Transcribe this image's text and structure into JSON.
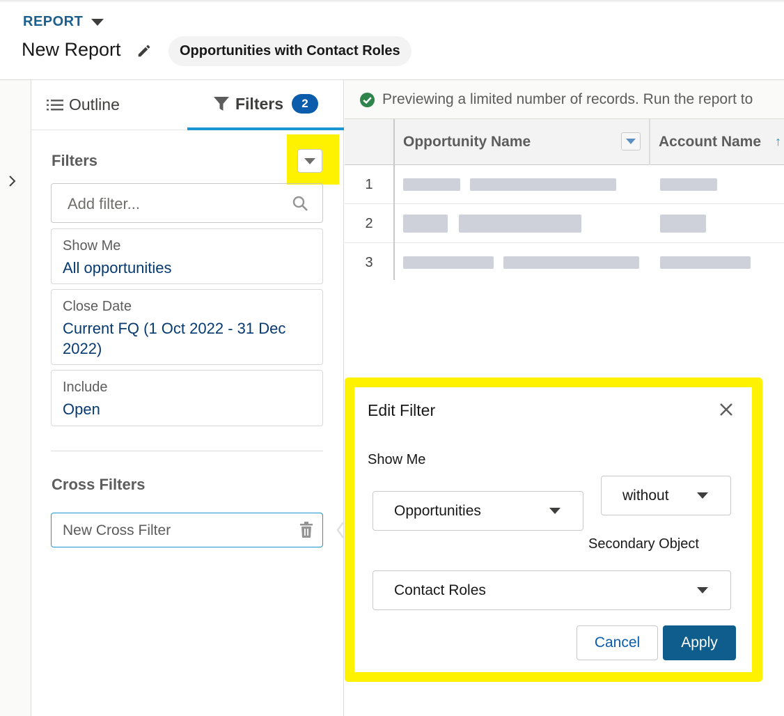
{
  "header": {
    "object_label": "REPORT",
    "report_title": "New Report",
    "report_type": "Opportunities with Contact Roles"
  },
  "panel": {
    "tabs": {
      "outline": "Outline",
      "filters": "Filters",
      "filters_count": "2"
    },
    "filters_section_title": "Filters",
    "add_filter_placeholder": "Add filter...",
    "filter_cards": [
      {
        "label": "Show Me",
        "value": "All opportunities"
      },
      {
        "label": "Close Date",
        "value": "Current FQ (1 Oct 2022 - 31 Dec 2022)"
      },
      {
        "label": "Include",
        "value": "Open"
      }
    ],
    "cross_filters_title": "Cross Filters",
    "cross_filter_item": "New Cross Filter"
  },
  "preview": {
    "notice": "Previewing a limited number of records. Run the report to",
    "columns": [
      "Opportunity Name",
      "Account Name"
    ],
    "rows": [
      "1",
      "2",
      "3"
    ]
  },
  "edit_filter": {
    "title": "Edit Filter",
    "show_me_label": "Show Me",
    "object_value": "Opportunities",
    "operator_value": "without",
    "secondary_object_label": "Secondary Object",
    "secondary_object_value": "Contact Roles",
    "cancel_label": "Cancel",
    "apply_label": "Apply"
  },
  "colors": {
    "highlight": "#fff200",
    "brand_blue": "#0b5cab",
    "apply_button": "#0f5d8c",
    "active_tab": "#1b96d3",
    "success": "#2e844a"
  }
}
